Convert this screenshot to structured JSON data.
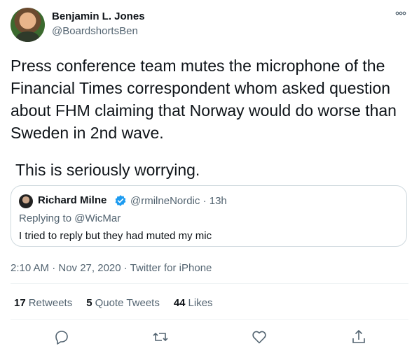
{
  "author": {
    "name": "Benjamin L. Jones",
    "handle": "@BoardshortsBen"
  },
  "tweet": {
    "text": "Press conference team mutes the microphone of the Financial Times correspondent whom asked question about FHM claiming that Norway would do worse than Sweden in 2nd wave.",
    "text2": "This is seriously worrying."
  },
  "quote": {
    "name": "Richard Milne",
    "handle_time": "@rmilneNordic · 13h",
    "replying_to": "Replying to @WicMar",
    "text": "I tried to reply but they had muted my mic"
  },
  "meta": {
    "timestamp_source": "2:10 AM · Nov 27, 2020 · Twitter for iPhone"
  },
  "stats": {
    "retweets_count": "17",
    "retweets_label": "Retweets",
    "quote_count": "5",
    "quote_label": "Quote Tweets",
    "likes_count": "44",
    "likes_label": "Likes"
  },
  "icons": {
    "more": "more-icon",
    "reply": "reply-icon",
    "retweet": "retweet-icon",
    "like": "like-icon",
    "share": "share-icon",
    "verified": "verified-badge-icon"
  },
  "colors": {
    "secondary_text": "#536471",
    "verified_blue": "#1d9bf0",
    "border": "#cfd9de"
  }
}
